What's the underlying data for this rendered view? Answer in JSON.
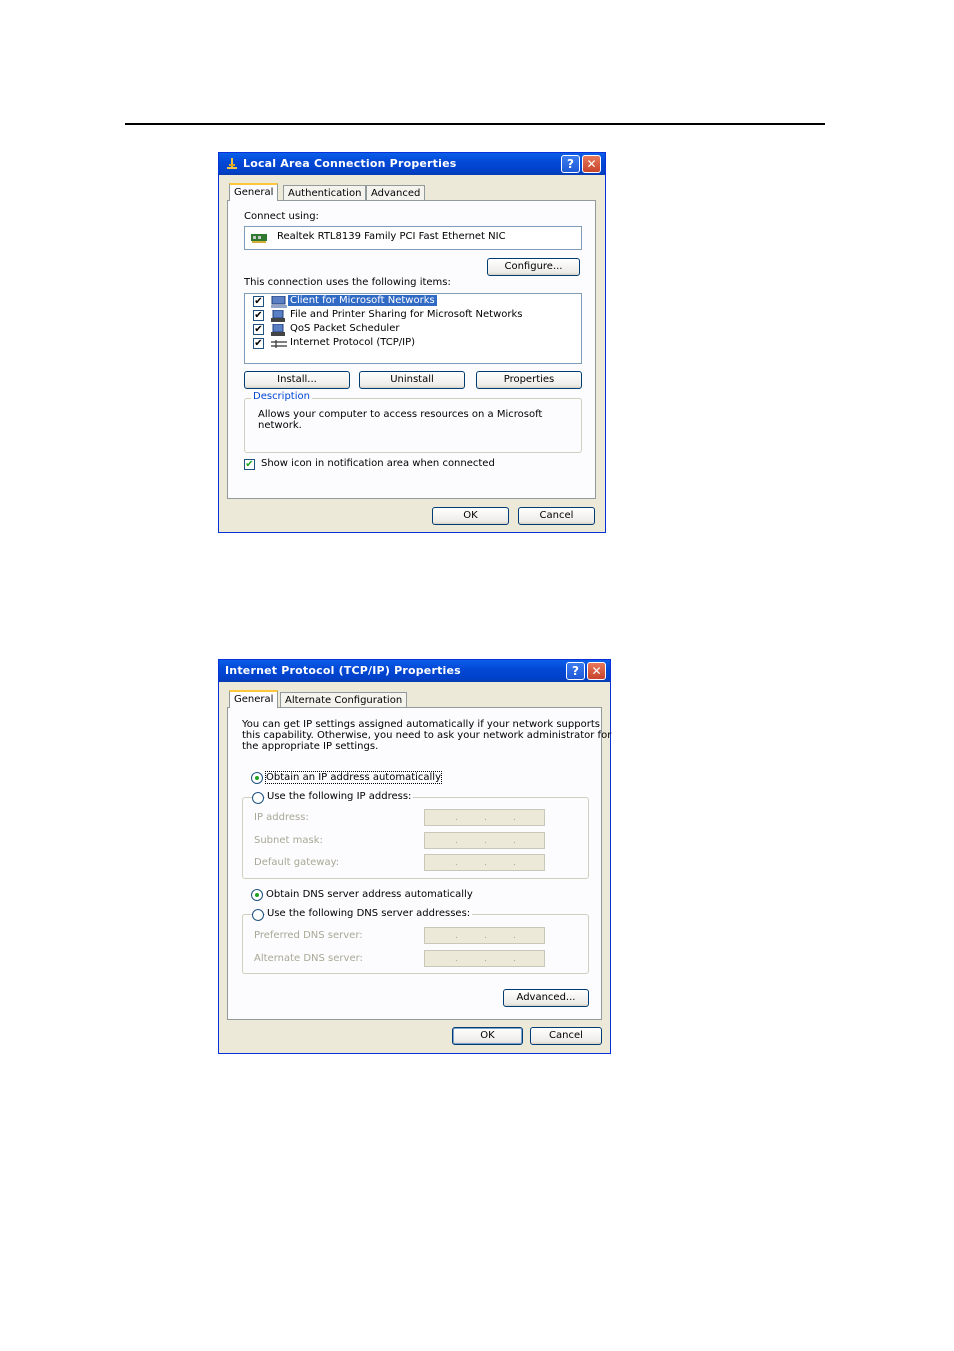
{
  "dialog1": {
    "title": "Local Area Connection Properties",
    "tabs": [
      "General",
      "Authentication",
      "Advanced"
    ],
    "connect_using_label": "Connect using:",
    "adapter_name": "Realtek RTL8139 Family PCI Fast Ethernet NIC",
    "configure_button": "Configure...",
    "items_label": "This connection uses the following items:",
    "items": [
      {
        "label": "Client for Microsoft Networks",
        "checked": true,
        "selected": true
      },
      {
        "label": "File and Printer Sharing for Microsoft Networks",
        "checked": true,
        "selected": false
      },
      {
        "label": "QoS Packet Scheduler",
        "checked": true,
        "selected": false
      },
      {
        "label": "Internet Protocol (TCP/IP)",
        "checked": true,
        "selected": false
      }
    ],
    "install_button": "Install...",
    "uninstall_button": "Uninstall",
    "properties_button": "Properties",
    "description_legend": "Description",
    "description_text_line1": "Allows your computer to access resources on a Microsoft",
    "description_text_line2": "network.",
    "show_icon_label": "Show icon in notification area when connected",
    "show_icon_checked": true,
    "ok_button": "OK",
    "cancel_button": "Cancel"
  },
  "dialog2": {
    "title": "Internet Protocol (TCP/IP) Properties",
    "tabs": [
      "General",
      "Alternate Configuration"
    ],
    "intro_line1": "You can get IP settings assigned automatically if your network supports",
    "intro_line2": "this capability. Otherwise, you need to ask your network administrator for",
    "intro_line3": "the appropriate IP settings.",
    "obtain_ip_auto": "Obtain an IP address automatically",
    "use_following_ip": "Use the following IP address:",
    "ip_address_label": "IP address:",
    "subnet_mask_label": "Subnet mask:",
    "default_gateway_label": "Default gateway:",
    "obtain_dns_auto": "Obtain DNS server address automatically",
    "use_following_dns": "Use the following DNS server addresses:",
    "preferred_dns_label": "Preferred DNS server:",
    "alternate_dns_label": "Alternate DNS server:",
    "ip_mode": "automatic",
    "dns_mode": "automatic",
    "advanced_button": "Advanced...",
    "ok_button": "OK",
    "cancel_button": "Cancel"
  },
  "icons": {
    "help": "?",
    "close": "✕",
    "check": "✔"
  }
}
